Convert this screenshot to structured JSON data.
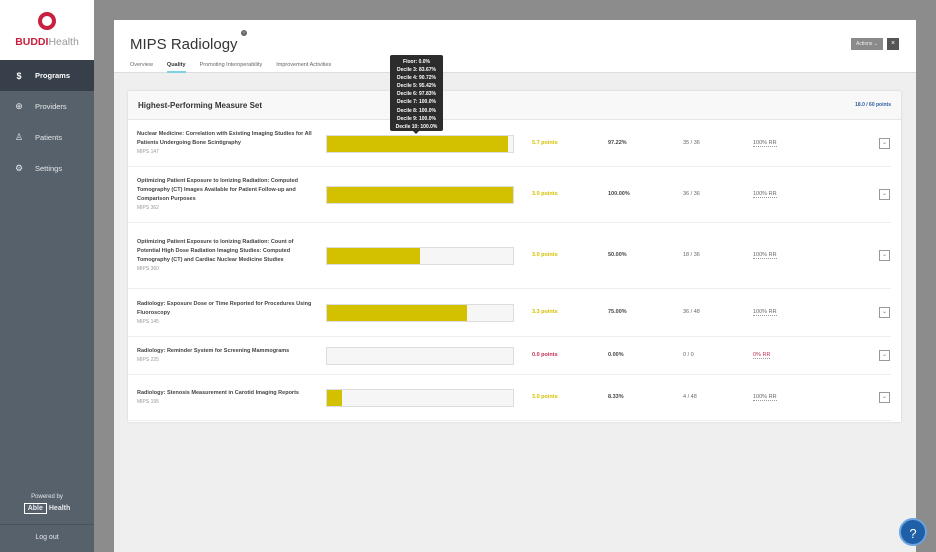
{
  "brand": {
    "name_bold": "BUDDI",
    "name_light": "Health",
    "color": "#c8213f"
  },
  "sidebar": {
    "items": [
      {
        "icon": "dollar-icon",
        "glyph": "$",
        "label": "Programs"
      },
      {
        "icon": "plus-circle-icon",
        "glyph": "⊕",
        "label": "Providers"
      },
      {
        "icon": "person-icon",
        "glyph": "♙",
        "label": "Patients"
      },
      {
        "icon": "gear-icon",
        "glyph": "⚙",
        "label": "Settings"
      }
    ],
    "powered_by": "Powered by",
    "able": "Able",
    "health": "Health",
    "logout": "Log out"
  },
  "modal": {
    "title": "MIPS Radiology",
    "help_glyph": "?",
    "actions_label": "Actions ⌄",
    "close_glyph": "×",
    "tabs": [
      "Overview",
      "Quality",
      "Promoting Interoperability",
      "Improvement Activities"
    ],
    "active_tab": "Quality"
  },
  "card": {
    "title": "Highest-Performing Measure Set",
    "points": "18.0 / 60 points"
  },
  "measures": [
    {
      "name": "Nuclear Medicine: Correlation with Existing Imaging Studies for All Patients Undergoing Bone Scintigraphy",
      "id": "MIPS 147",
      "fill": 97.22,
      "points": "5.7 points",
      "pct": "97.22%",
      "count": "35 / 36",
      "rr": "100% RR"
    },
    {
      "name": "Optimizing Patient Exposure to Ionizing Radiation: Computed Tomography (CT) Images Available for Patient Follow-up and Comparison Purposes",
      "id": "MIPS 362",
      "fill": 100,
      "points": "3.0 points",
      "pct": "100.00%",
      "count": "36 / 36",
      "rr": "100% RR"
    },
    {
      "name": "Optimizing Patient Exposure to Ionizing Radiation: Count of Potential High Dose Radiation Imaging Studies: Computed Tomography (CT) and Cardiac Nuclear Medicine Studies",
      "id": "MIPS 360",
      "fill": 50,
      "points": "3.0 points",
      "pct": "50.00%",
      "count": "18 / 36",
      "rr": "100% RR"
    },
    {
      "name": "Radiology: Exposure Dose or Time Reported for Procedures Using Fluoroscopy",
      "id": "MIPS 145",
      "fill": 75,
      "points": "3.3 points",
      "pct": "75.00%",
      "count": "36 / 48",
      "rr": "100% RR"
    },
    {
      "name": "Radiology: Reminder System for Screening Mammograms",
      "id": "MIPS 225",
      "fill": 0,
      "points": "0.0 points",
      "pct": "0.00%",
      "count": "0 / 0",
      "rr": "0% RR",
      "bad": true
    },
    {
      "name": "Radiology: Stenosis Measurement in Carotid Imaging Reports",
      "id": "MIPS 195",
      "fill": 8.33,
      "points": "3.0 points",
      "pct": "8.33%",
      "count": "4 / 48",
      "rr": "100% RR"
    }
  ],
  "tooltip": [
    "Floor: 0.0%",
    "Decile 3: 83.67%",
    "Decile 4: 90.72%",
    "Decile 5: 95.42%",
    "Decile 6: 97.83%",
    "Decile 7: 100.0%",
    "Decile 8: 100.0%",
    "Decile 9: 100.0%",
    "Decile 10: 100.0%"
  ],
  "help": "?"
}
